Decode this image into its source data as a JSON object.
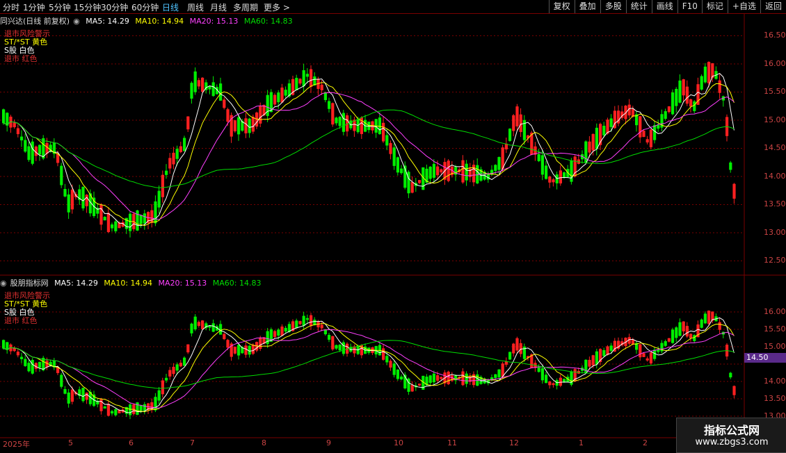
{
  "toolbar": {
    "timeframes": [
      "分时",
      "1分钟",
      "5分钟",
      "15分钟",
      "30分钟",
      "60分钟",
      "日线",
      "周线",
      "月线",
      "多周期"
    ],
    "active": "日线",
    "more": "更多 >",
    "actions": [
      "复权",
      "叠加",
      "多股",
      "统计",
      "画线",
      "F10",
      "标记",
      "+自选",
      "返回"
    ]
  },
  "top_panel": {
    "title": "同兴达(日线 前复权)",
    "ma5": "MA5: 14.29",
    "ma10": "MA10: 14.94",
    "ma20": "MA20: 15.13",
    "ma60": "MA60: 14.83",
    "legend": [
      "退市风险警示",
      "ST/*ST 黄色",
      "S股 白色",
      "退市 红色"
    ],
    "y_labels": [
      "16.50",
      "16.00",
      "15.50",
      "15.00",
      "14.50",
      "14.00",
      "13.50",
      "13.00",
      "12.50"
    ]
  },
  "bottom_panel": {
    "title": "股朋指标网",
    "ma5": "MA5: 14.29",
    "ma10": "MA10: 14.94",
    "ma20": "MA20: 15.13",
    "ma60": "MA60: 14.83",
    "legend": [
      "退市风险警示",
      "ST/*ST 黄色",
      "S股 白色",
      "退市 红色"
    ],
    "y_labels": [
      "16.00",
      "15.50",
      "15.00",
      "14.50",
      "14.00",
      "13.50",
      "13.00"
    ],
    "price_marker": "14.50"
  },
  "x_labels": [
    "2025年",
    "5",
    "6",
    "7",
    "8",
    "9",
    "10",
    "11",
    "12",
    "1",
    "2"
  ],
  "badge": {
    "title": "指标公式网",
    "url": "www.zbgs3.com"
  },
  "colors": {
    "up": "#ff2020",
    "down": "#00ee00",
    "ma5": "#ffffff",
    "ma10": "#ffff00",
    "ma20": "#ff40ff",
    "ma60": "#00dd00",
    "grid": "#7a0000"
  }
}
